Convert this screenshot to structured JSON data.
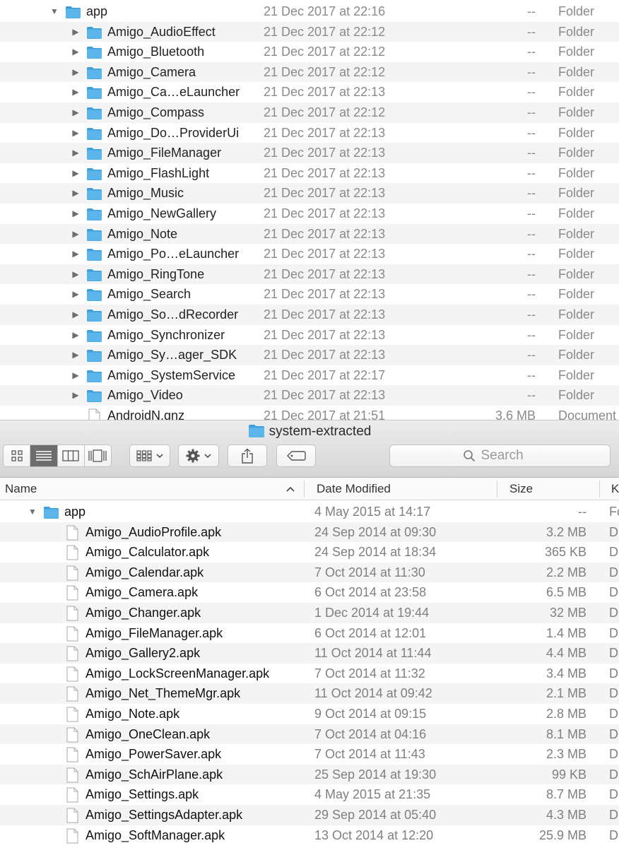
{
  "colors": {
    "folder": "#5bb4ea",
    "folder_dark": "#3e9fdb",
    "stripe": "#f4f4f4",
    "active_view": "#6d6d6d"
  },
  "top_window": {
    "rows": [
      {
        "kind_row": "folder",
        "expanded": true,
        "depth": 0,
        "name": "app",
        "date": "21 Dec 2017 at 22:16",
        "size": "--",
        "kind": "Folder"
      },
      {
        "kind_row": "folder",
        "expanded": false,
        "depth": 1,
        "name": "Amigo_AudioEffect",
        "date": "21 Dec 2017 at 22:12",
        "size": "--",
        "kind": "Folder"
      },
      {
        "kind_row": "folder",
        "expanded": false,
        "depth": 1,
        "name": "Amigo_Bluetooth",
        "date": "21 Dec 2017 at 22:12",
        "size": "--",
        "kind": "Folder"
      },
      {
        "kind_row": "folder",
        "expanded": false,
        "depth": 1,
        "name": "Amigo_Camera",
        "date": "21 Dec 2017 at 22:12",
        "size": "--",
        "kind": "Folder"
      },
      {
        "kind_row": "folder",
        "expanded": false,
        "depth": 1,
        "name": "Amigo_Ca…eLauncher",
        "date": "21 Dec 2017 at 22:13",
        "size": "--",
        "kind": "Folder"
      },
      {
        "kind_row": "folder",
        "expanded": false,
        "depth": 1,
        "name": "Amigo_Compass",
        "date": "21 Dec 2017 at 22:12",
        "size": "--",
        "kind": "Folder"
      },
      {
        "kind_row": "folder",
        "expanded": false,
        "depth": 1,
        "name": "Amigo_Do…ProviderUi",
        "date": "21 Dec 2017 at 22:13",
        "size": "--",
        "kind": "Folder"
      },
      {
        "kind_row": "folder",
        "expanded": false,
        "depth": 1,
        "name": "Amigo_FileManager",
        "date": "21 Dec 2017 at 22:13",
        "size": "--",
        "kind": "Folder"
      },
      {
        "kind_row": "folder",
        "expanded": false,
        "depth": 1,
        "name": "Amigo_FlashLight",
        "date": "21 Dec 2017 at 22:13",
        "size": "--",
        "kind": "Folder"
      },
      {
        "kind_row": "folder",
        "expanded": false,
        "depth": 1,
        "name": "Amigo_Music",
        "date": "21 Dec 2017 at 22:13",
        "size": "--",
        "kind": "Folder"
      },
      {
        "kind_row": "folder",
        "expanded": false,
        "depth": 1,
        "name": "Amigo_NewGallery",
        "date": "21 Dec 2017 at 22:13",
        "size": "--",
        "kind": "Folder"
      },
      {
        "kind_row": "folder",
        "expanded": false,
        "depth": 1,
        "name": "Amigo_Note",
        "date": "21 Dec 2017 at 22:13",
        "size": "--",
        "kind": "Folder"
      },
      {
        "kind_row": "folder",
        "expanded": false,
        "depth": 1,
        "name": "Amigo_Po…eLauncher",
        "date": "21 Dec 2017 at 22:13",
        "size": "--",
        "kind": "Folder"
      },
      {
        "kind_row": "folder",
        "expanded": false,
        "depth": 1,
        "name": "Amigo_RingTone",
        "date": "21 Dec 2017 at 22:13",
        "size": "--",
        "kind": "Folder"
      },
      {
        "kind_row": "folder",
        "expanded": false,
        "depth": 1,
        "name": "Amigo_Search",
        "date": "21 Dec 2017 at 22:13",
        "size": "--",
        "kind": "Folder"
      },
      {
        "kind_row": "folder",
        "expanded": false,
        "depth": 1,
        "name": "Amigo_So…dRecorder",
        "date": "21 Dec 2017 at 22:13",
        "size": "--",
        "kind": "Folder"
      },
      {
        "kind_row": "folder",
        "expanded": false,
        "depth": 1,
        "name": "Amigo_Synchronizer",
        "date": "21 Dec 2017 at 22:13",
        "size": "--",
        "kind": "Folder"
      },
      {
        "kind_row": "folder",
        "expanded": false,
        "depth": 1,
        "name": "Amigo_Sy…ager_SDK",
        "date": "21 Dec 2017 at 22:13",
        "size": "--",
        "kind": "Folder"
      },
      {
        "kind_row": "folder",
        "expanded": false,
        "depth": 1,
        "name": "Amigo_SystemService",
        "date": "21 Dec 2017 at 22:17",
        "size": "--",
        "kind": "Folder"
      },
      {
        "kind_row": "folder",
        "expanded": false,
        "depth": 1,
        "name": "Amigo_Video",
        "date": "21 Dec 2017 at 22:13",
        "size": "--",
        "kind": "Folder"
      },
      {
        "kind_row": "file",
        "expanded": false,
        "depth": 1,
        "name": "AndroidN.gnz",
        "date": "21 Dec 2017 at 21:51",
        "size": "3.6 MB",
        "kind": "Document"
      }
    ]
  },
  "bottom_window": {
    "title": "system-extracted",
    "toolbar": {
      "view_modes": [
        "icon-view",
        "list-view",
        "column-view",
        "cover-flow-view"
      ],
      "active_view": "list-view",
      "search_placeholder": "Search"
    },
    "columns": {
      "name": "Name",
      "date": "Date Modified",
      "size": "Size",
      "kind": "K"
    },
    "rows": [
      {
        "kind_row": "folder",
        "expanded": true,
        "depth": 0,
        "name": "app",
        "date": "4 May 2015 at 14:17",
        "size": "--",
        "kind": "Fo"
      },
      {
        "kind_row": "file",
        "depth": 1,
        "name": "Amigo_AudioProfile.apk",
        "date": "24 Sep 2014 at 09:30",
        "size": "3.2 MB",
        "kind": "D"
      },
      {
        "kind_row": "file",
        "depth": 1,
        "name": "Amigo_Calculator.apk",
        "date": "24 Sep 2014 at 18:34",
        "size": "365 KB",
        "kind": "D"
      },
      {
        "kind_row": "file",
        "depth": 1,
        "name": "Amigo_Calendar.apk",
        "date": "7 Oct 2014 at 11:30",
        "size": "2.2 MB",
        "kind": "D"
      },
      {
        "kind_row": "file",
        "depth": 1,
        "name": "Amigo_Camera.apk",
        "date": "6 Oct 2014 at 23:58",
        "size": "6.5 MB",
        "kind": "D"
      },
      {
        "kind_row": "file",
        "depth": 1,
        "name": "Amigo_Changer.apk",
        "date": "1 Dec 2014 at 19:44",
        "size": "32 MB",
        "kind": "D"
      },
      {
        "kind_row": "file",
        "depth": 1,
        "name": "Amigo_FileManager.apk",
        "date": "6 Oct 2014 at 12:01",
        "size": "1.4 MB",
        "kind": "D"
      },
      {
        "kind_row": "file",
        "depth": 1,
        "name": "Amigo_Gallery2.apk",
        "date": "11 Oct 2014 at 11:44",
        "size": "4.4 MB",
        "kind": "D"
      },
      {
        "kind_row": "file",
        "depth": 1,
        "name": "Amigo_LockScreenManager.apk",
        "date": "7 Oct 2014 at 11:32",
        "size": "3.4 MB",
        "kind": "D"
      },
      {
        "kind_row": "file",
        "depth": 1,
        "name": "Amigo_Net_ThemeMgr.apk",
        "date": "11 Oct 2014 at 09:42",
        "size": "2.1 MB",
        "kind": "D"
      },
      {
        "kind_row": "file",
        "depth": 1,
        "name": "Amigo_Note.apk",
        "date": "9 Oct 2014 at 09:15",
        "size": "2.8 MB",
        "kind": "D"
      },
      {
        "kind_row": "file",
        "depth": 1,
        "name": "Amigo_OneClean.apk",
        "date": "7 Oct 2014 at 04:16",
        "size": "8.1 MB",
        "kind": "D"
      },
      {
        "kind_row": "file",
        "depth": 1,
        "name": "Amigo_PowerSaver.apk",
        "date": "7 Oct 2014 at 11:43",
        "size": "2.3 MB",
        "kind": "D"
      },
      {
        "kind_row": "file",
        "depth": 1,
        "name": "Amigo_SchAirPlane.apk",
        "date": "25 Sep 2014 at 19:30",
        "size": "99 KB",
        "kind": "D"
      },
      {
        "kind_row": "file",
        "depth": 1,
        "name": "Amigo_Settings.apk",
        "date": "4 May 2015 at 21:35",
        "size": "8.7 MB",
        "kind": "D"
      },
      {
        "kind_row": "file",
        "depth": 1,
        "name": "Amigo_SettingsAdapter.apk",
        "date": "29 Sep 2014 at 05:40",
        "size": "4.3 MB",
        "kind": "D"
      },
      {
        "kind_row": "file",
        "depth": 1,
        "name": "Amigo_SoftManager.apk",
        "date": "13 Oct 2014 at 12:20",
        "size": "25.9 MB",
        "kind": "D"
      }
    ]
  }
}
